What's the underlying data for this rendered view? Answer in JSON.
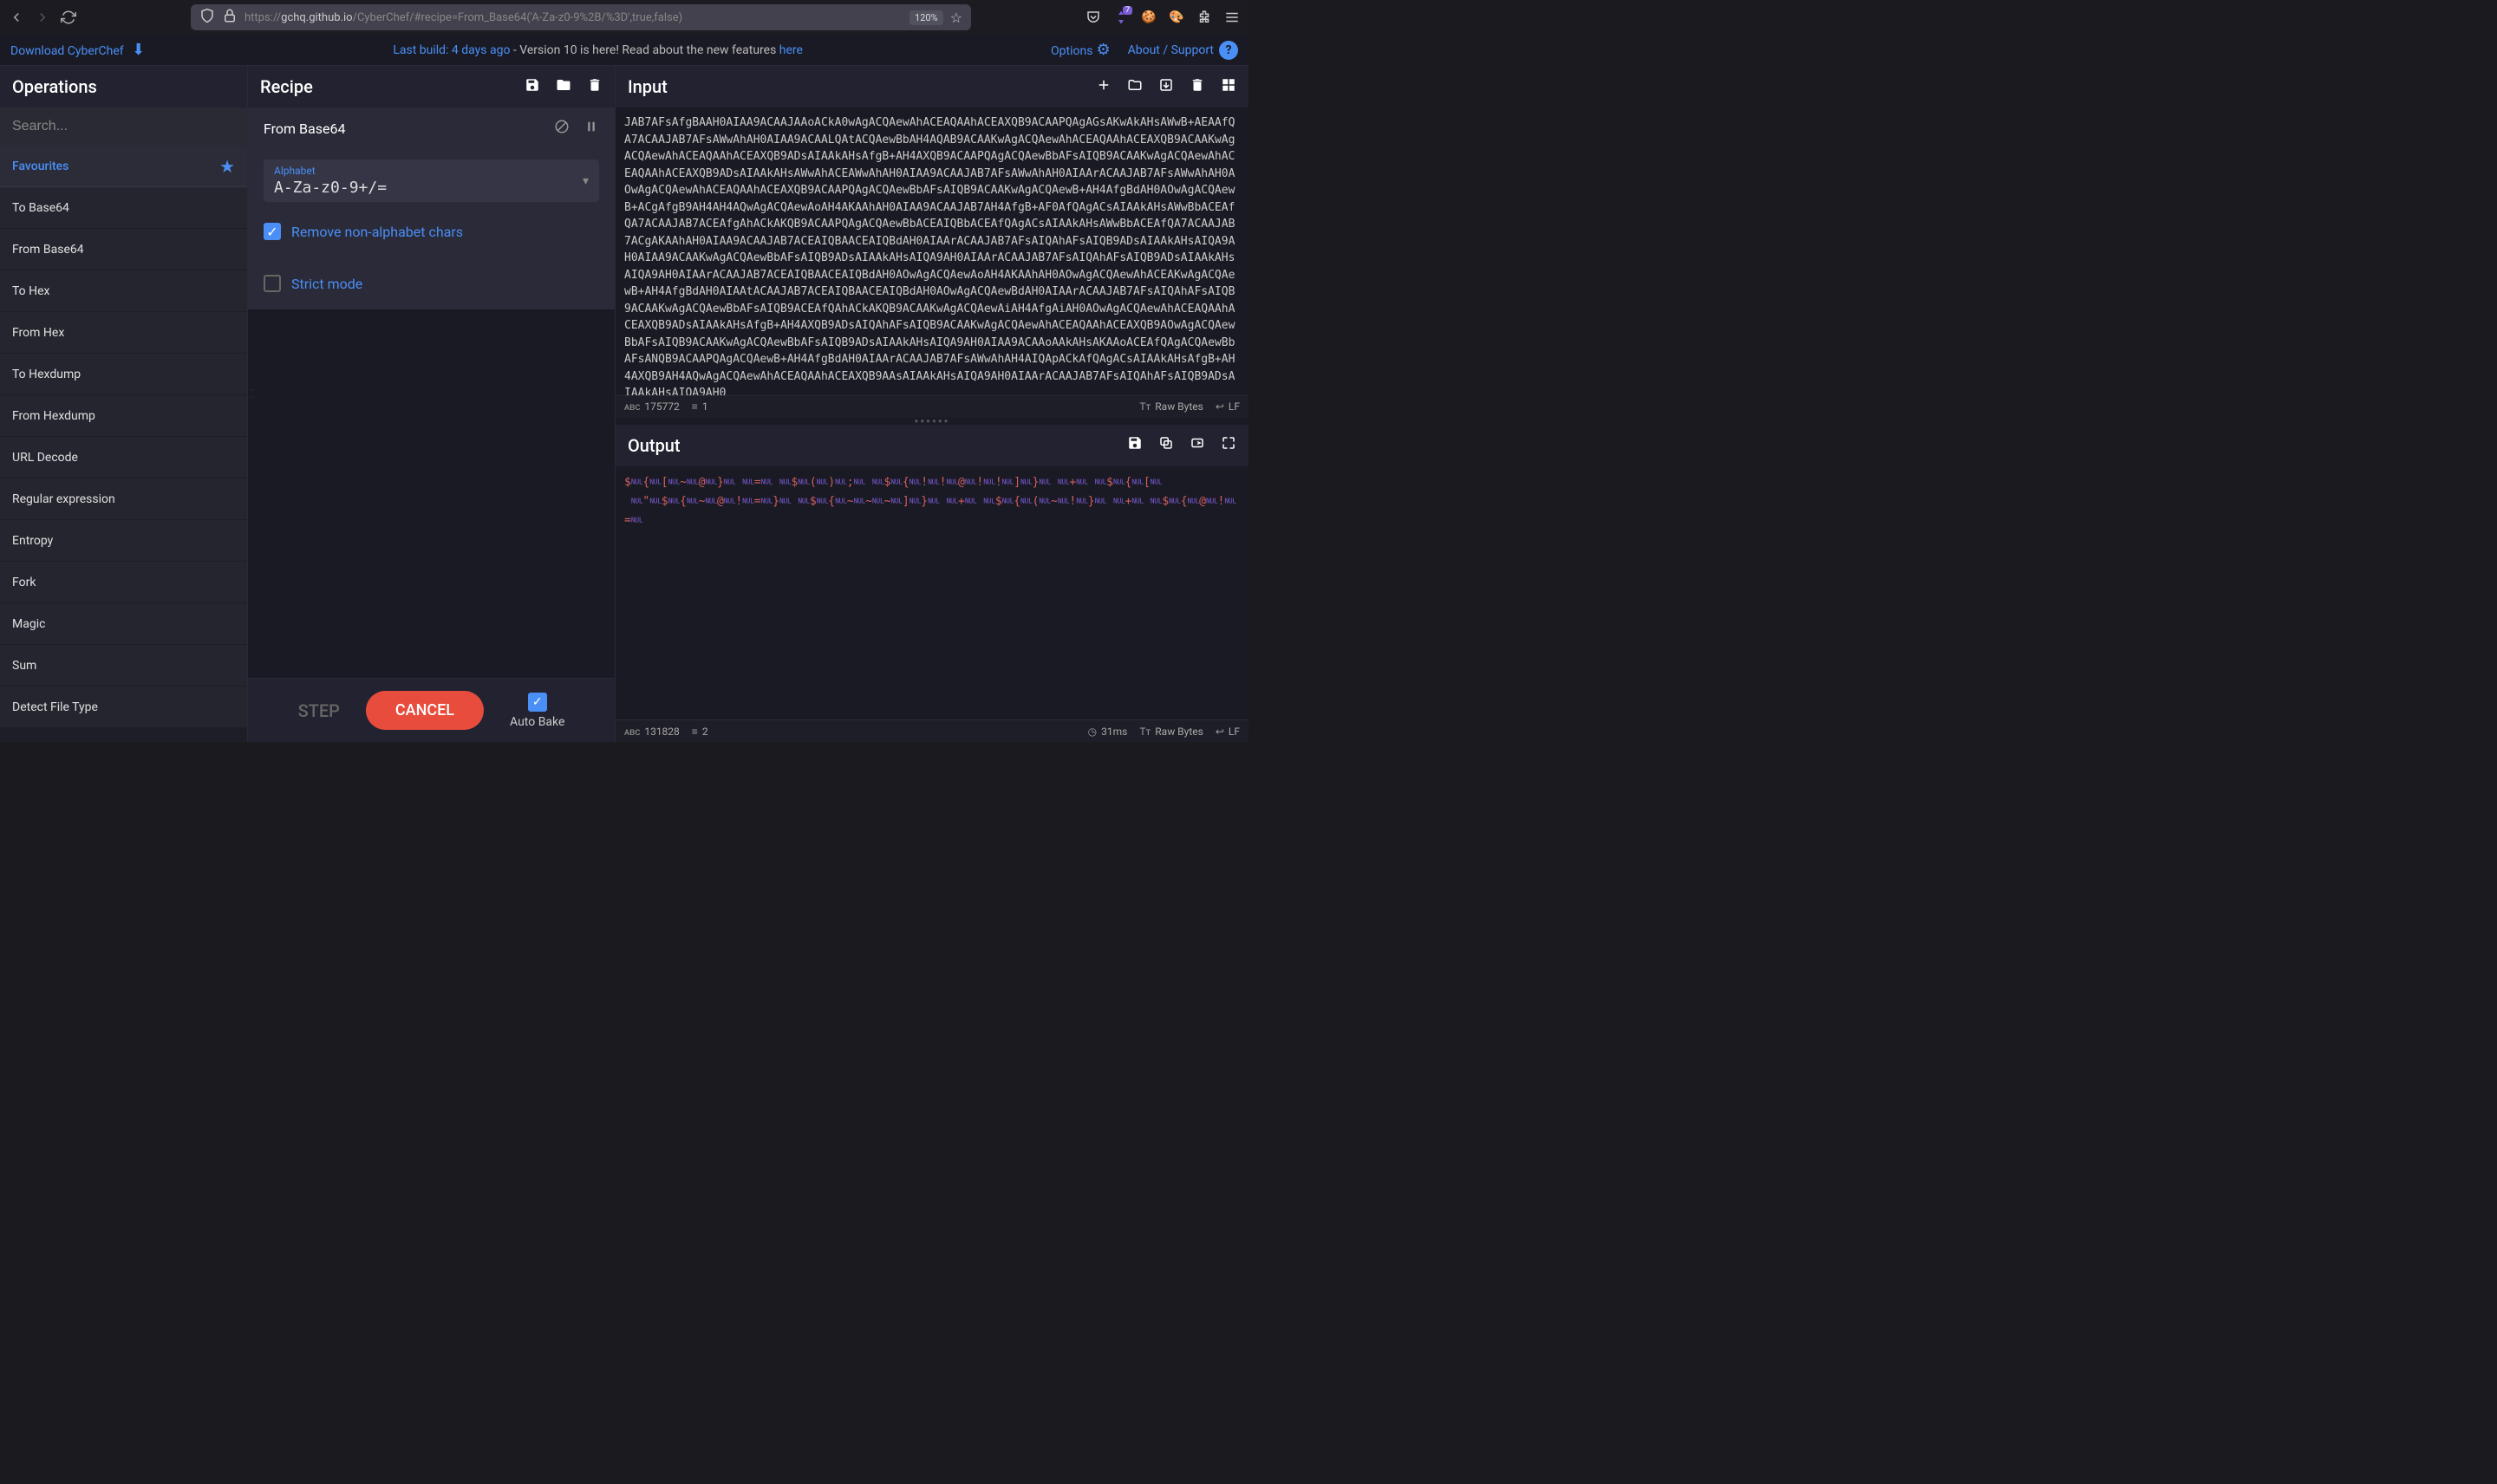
{
  "browser": {
    "url_prefix": "https://",
    "url_bold": "gchq.github.io",
    "url_rest": "/CyberChef/#recipe=From_Base64('A-Za-z0-9%2B/%3D',true,false)",
    "zoom": "120%",
    "badge": "7"
  },
  "header": {
    "download": "Download CyberChef",
    "last_build": "Last build: 4 days ago",
    "version_text": " - Version 10 is here! Read about the new features ",
    "here": "here",
    "options": "Options",
    "about": "About / Support"
  },
  "operations": {
    "title": "Operations",
    "search_placeholder": "Search...",
    "favourites": "Favourites",
    "items": [
      "To Base64",
      "From Base64",
      "To Hex",
      "From Hex",
      "To Hexdump",
      "From Hexdump",
      "URL Decode",
      "Regular expression",
      "Entropy",
      "Fork",
      "Magic",
      "Sum",
      "Detect File Type"
    ]
  },
  "recipe": {
    "title": "Recipe",
    "op_name": "From Base64",
    "alphabet_label": "Alphabet",
    "alphabet_value": "A-Za-z0-9+/=",
    "remove_chars": "Remove non-alphabet chars",
    "strict_mode": "Strict mode",
    "step": "STEP",
    "cancel": "CANCEL",
    "autobake": "Auto Bake"
  },
  "input": {
    "title": "Input",
    "text": "JAB7AFsAfgBAAH0AIAA9ACAAJAAoACkA0wAgACQAewAhACEAQAAhACEAXQB9ACAAPQAgAGsAKwAkAHsAWwB+AEAAfQA7ACAAJAB7AFsAWwAhAH0AIAA9ACAALQAtACQAewBbAH4AQAB9ACAAKwAgACQAewAhACEAQAAhACEAXQB9ACAAKwAgACQAewAhACEAQAAhACEAXQB9ADsAIAAkAHsAfgB+AH4AXQB9ACAAPQAgACQAewBbAFsAIQB9ACAAKwAgACQAewAhACEAQAAhACEAXQB9ADsAIAAkAHsAWwAhACEAWwAhAH0AIAA9ACAAJAB7AFsAWwAhAH0AIAArACAAJAB7AFsAWwAhAH0AOwAgACQAewAhACEAQAAhACEAXQB9ACAAPQAgACQAewBbAFsAIQB9ACAAKwAgACQAewB+AH4AfgBdAH0AOwAgACQAewB+ACgAfgB9AH4AH4AQwAgACQAewAoAH4AKAAhAH0AIAA9ACAAJAB7AH4AfgB+AF0AfQAgACsAIAAkAHsAWwBbACEAfQA7ACAAJAB7ACEAfgAhACkAKQB9ACAAPQAgACQAewBbACEAIQBbACEAfQAgACsAIAAkAHsAWwBbACEAfQA7ACAAJAB7ACgAKAAhAH0AIAA9ACAAJAB7ACEAIQBAACEAIQBdAH0AIAArACAAJAB7AFsAIQAhAFsAIQB9ADsAIAAkAHsAIQA9AH0AIAA9ACAAKwAgACQAewBbAFsAIQB9ADsAIAAkAHsAIQA9AH0AIAArACAAJAB7AFsAIQAhAFsAIQB9ADsAIAAkAHsAIQA9AH0AIAArACAAJAB7ACEAIQBAACEAIQBdAH0AOwAgACQAewAoAH4AKAAhAH0AOwAgACQAewAhACEAKwAgACQAewB+AH4AfgBdAH0AIAAtACAAJAB7ACEAIQBAACEAIQBdAH0AOwAgACQAewBdAH0AIAArACAAJAB7AFsAIQAhAFsAIQB9ACAAKwAgACQAewBbAFsAIQB9ACEAfQAhACkAKQB9ACAAKwAgACQAewAiAH4AfgAiAH0AOwAgACQAewAhACEAQAAhACEAXQB9ADsAIAAkAHsAfgB+AH4AXQB9ADsAIQAhAFsAIQB9ACAAKwAgACQAewAhACEAQAAhACEAXQB9AOwAgACQAewBbAFsAIQB9ACAAKwAgACQAewBbAFsAIQB9ADsAIAAkAHsAIQA9AH0AIAA9ACAAoAAkAHsAKAAoACEAfQAgACQAewBbAFsANQB9ACAAPQAgACQAewB+AH4AfgBdAH0AIAArACAAJAB7AFsAWwAhAH4AIQApACkAfQAgACsAIAAkAHsAfgB+AH4AXQB9AH4AQwAgACQAewAhACEAQAAhACEAXQB9AAsAIAAkAHsAIQA9AH0AIAArACAAJAB7AFsAIQAhAFsAIQB9ADsAIAAkAHsAIQA9AH0",
    "char_count": "175772",
    "line_count": "1",
    "encoding": "Raw Bytes",
    "eol": "LF"
  },
  "output": {
    "title": "Output",
    "char_count": "131828",
    "line_count": "2",
    "time": "31ms",
    "encoding": "Raw Bytes",
    "eol": "LF"
  }
}
